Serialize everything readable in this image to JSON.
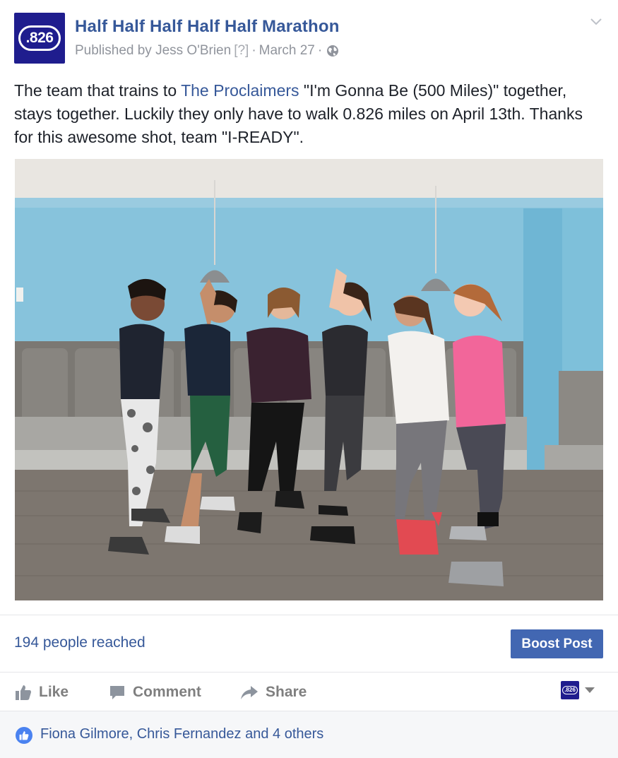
{
  "header": {
    "avatar_text": ".826",
    "page_name": "Half Half Half Half Half Marathon",
    "published_by": "Published by Jess O'Brien",
    "help_marker": "[?]",
    "separator": "·",
    "date": "March 27",
    "privacy_icon": "globe-icon",
    "menu_icon": "chevron-down-icon"
  },
  "post": {
    "text_before_link": "The team that trains to ",
    "link_text": "The Proclaimers",
    "text_after_link": " \"I'm Gonna Be (500 Miles)\" together, stays together. Luckily they only have to walk 0.826 miles on April 13th. Thanks for this awesome shot, team \"I-READY\"."
  },
  "insights": {
    "reach_text": "194 people reached",
    "boost_label": "Boost Post"
  },
  "actions": {
    "like_label": "Like",
    "comment_label": "Comment",
    "share_label": "Share",
    "page_switch_text": ".826"
  },
  "reactions": {
    "summary": "Fiona Gilmore, Chris Fernandez and 4 others"
  },
  "colors": {
    "link_blue": "#365899",
    "boost_blue": "#4267b2",
    "brand_navy": "#1f1d8e",
    "muted_gray": "#90949c"
  }
}
